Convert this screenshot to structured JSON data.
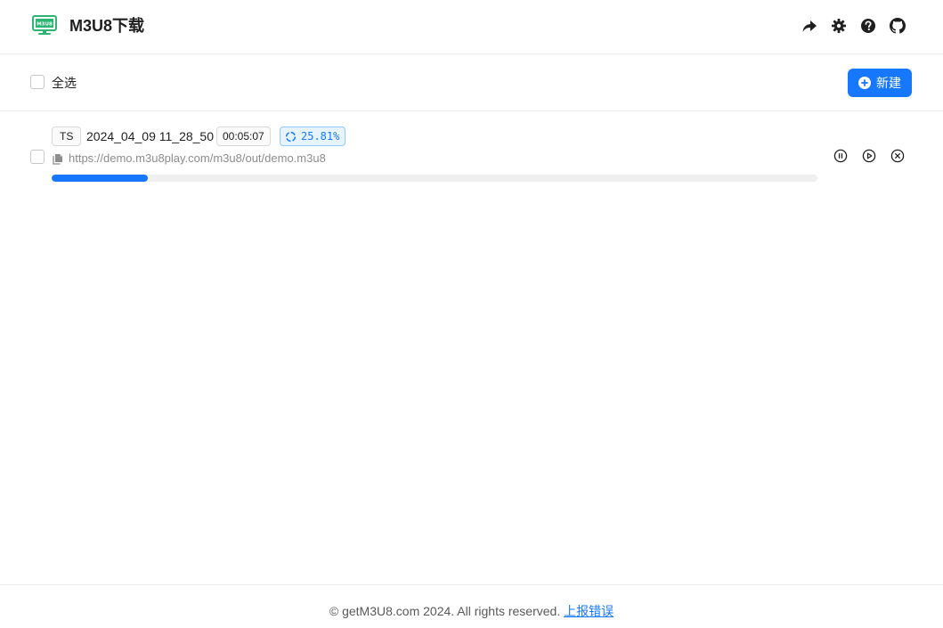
{
  "header": {
    "app_title": "M3U8下载",
    "logo_text": "M3U8",
    "icons": [
      "share-icon",
      "gear-icon",
      "help-icon",
      "github-icon"
    ]
  },
  "toolbar": {
    "select_all_label": "全选",
    "new_button_label": "新建"
  },
  "tasks": [
    {
      "type": "TS",
      "name": "2024_04_09 11_28_50",
      "duration": "00:05:07",
      "progress_label": "25.81%",
      "progress": 0.125,
      "url": "https://demo.m3u8play.com/m3u8/out/demo.m3u8",
      "actions": [
        "pause-icon",
        "play-icon",
        "cancel-icon"
      ]
    }
  ],
  "footer": {
    "copyright": "© getM3U8.com 2024. All rights reserved.",
    "report_link": "上报错误"
  },
  "colors": {
    "accent": "#1677ff",
    "logo": "#2bb673"
  }
}
